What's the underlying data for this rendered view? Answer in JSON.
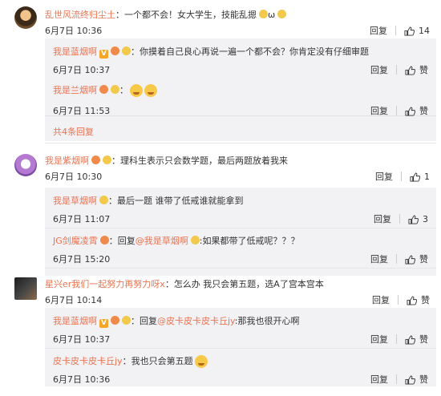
{
  "actions": {
    "reply": "回复",
    "like": "赞"
  },
  "threads": [
    {
      "user": "乱世风流终归尘土",
      "sep": "：",
      "text": "一个都不会！女大学生，技能乱摁",
      "suffix": "ω",
      "time": "6月7日 10:36",
      "likes": "14",
      "replies": [
        {
          "user": "我是蓝烟啊",
          "sep": "：",
          "text": "你摸着自己良心再说一遍一个都不会？你肯定没有仔细审题",
          "time": "6月7日 10:37"
        },
        {
          "user": "我是兰烟啊",
          "sep": "：",
          "text": "",
          "time": "6月7日 11:53"
        }
      ],
      "more": "共4条回复"
    },
    {
      "user": "我是紫烟啊",
      "sep": "：",
      "text": "理科生表示只会数学题，最后两题放着我来",
      "time": "6月7日 10:30",
      "likes": "1",
      "replies": [
        {
          "user": "我是草烟啊",
          "sep": "：",
          "text": "最后一题 谁带了低戒谁就能拿到",
          "time": "6月7日 11:07",
          "likes": "3"
        },
        {
          "user": "JG剑魔凌霄",
          "sep": "：",
          "reply_word": "回复",
          "mention": "@我是草烟啊",
          "text": ":如果都带了低戒呢？？？",
          "time": "6月7日 15:20"
        }
      ]
    },
    {
      "user": "星兴er我们一起努力再努力呀x",
      "sep": "：",
      "text": "怎么办 我只会第五题，选A了宫本宫本",
      "time": "6月7日 10:14",
      "replies": [
        {
          "user": "我是蓝烟啊",
          "sep": "：",
          "reply_word": "回复",
          "mention": "@皮卡皮卡皮卡丘jy",
          "text": ":那我也很开心啊",
          "time": "6月7日 10:37"
        },
        {
          "user": "皮卡皮卡皮卡丘jy",
          "sep": "：",
          "text": "我也只会第五题",
          "time": "6月7日 10:36"
        }
      ]
    }
  ]
}
